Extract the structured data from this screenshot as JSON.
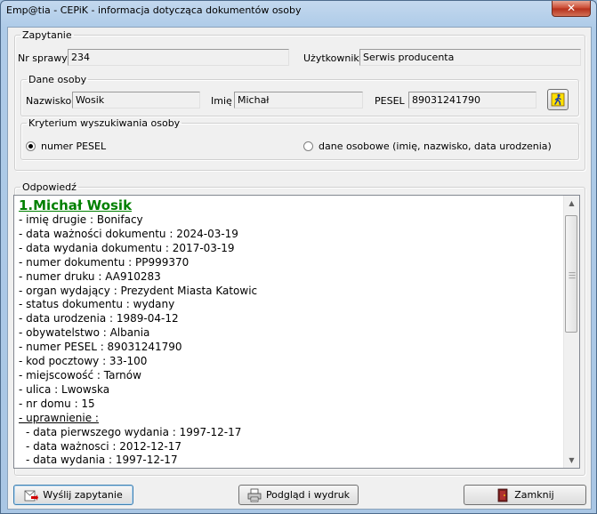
{
  "window": {
    "title": "Emp@tia - CEPiK - informacja dotycząca dokumentów osoby",
    "close_label": "✕"
  },
  "query": {
    "legend": "Zapytanie",
    "case_label": "Nr sprawy",
    "case_value": "234",
    "user_label": "Użytkownik",
    "user_value": "Serwis producenta"
  },
  "person": {
    "legend": "Dane osoby",
    "surname_label": "Nazwisko",
    "surname_value": "Wosik",
    "name_label": "Imię",
    "name_value": "Michał",
    "pesel_label": "PESEL",
    "pesel_value": "89031241790"
  },
  "criteria": {
    "legend": "Kryterium wyszukiwania osoby",
    "option_pesel": "numer PESEL",
    "option_personal": "dane osobowe (imię, nazwisko, data urodzenia)",
    "selected": "numer PESEL"
  },
  "answer": {
    "legend": "Odpowiedź",
    "heading": "1.Michał Wosik",
    "lines": [
      "- imię drugie : Bonifacy",
      "- data ważności dokumentu : 2024-03-19",
      "- data wydania dokumentu : 2017-03-19",
      "- numer dokumentu : PP999370",
      "- numer druku : AA910283",
      "- organ wydający : Prezydent Miasta Katowic",
      "- status dokumentu : wydany",
      "- data urodzenia : 1989-04-12",
      "- obywatelstwo : Albania",
      "- numer PESEL : 89031241790",
      "- kod pocztowy : 33-100",
      "- miejscowość : Tarnów",
      "- ulica : Lwowska",
      "- nr domu : 15"
    ],
    "section_label": "- uprawnienie :",
    "sub_lines": [
      "- data pierwszego wydania : 1997-12-17",
      "- data ważnosci : 2012-12-17",
      "- data wydania : 1997-12-17"
    ]
  },
  "buttons": {
    "send_label": "Wyślij zapytanie",
    "preview_label": "Podgląd i wydruk",
    "close_label": "Zamknij"
  },
  "colors": {
    "heading": "#008000",
    "titlebar": "#a9c6e4"
  }
}
